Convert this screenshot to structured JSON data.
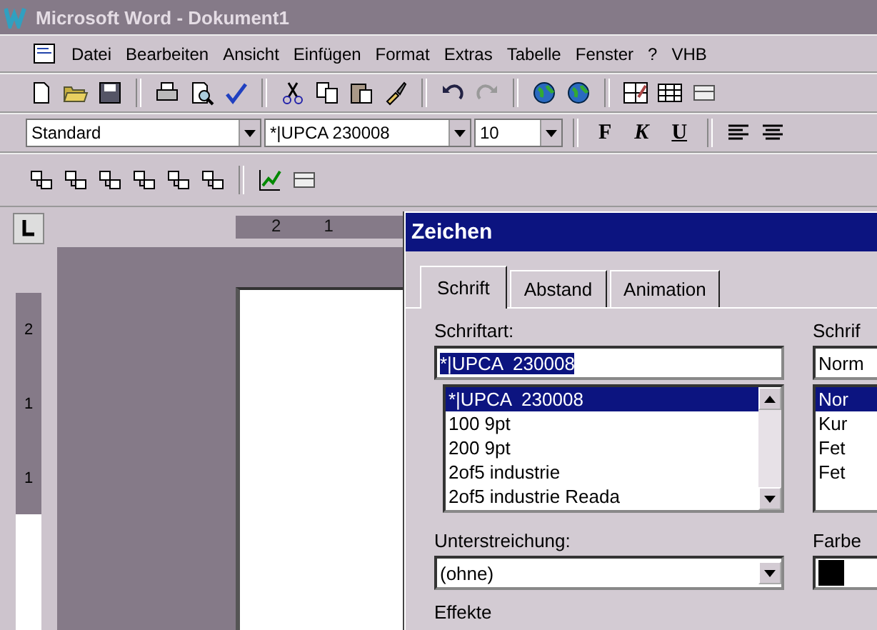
{
  "window": {
    "title": "Microsoft Word - Dokument1"
  },
  "menu": [
    "Datei",
    "Bearbeiten",
    "Ansicht",
    "Einfügen",
    "Format",
    "Extras",
    "Tabelle",
    "Fenster",
    "?",
    "VHB"
  ],
  "formatting": {
    "style": "Standard",
    "font": "*|UPCA  230008",
    "size": "10",
    "buttons": [
      {
        "label": "F",
        "kind": "bold"
      },
      {
        "label": "K",
        "kind": "italic"
      },
      {
        "label": "U",
        "kind": "underline"
      }
    ]
  },
  "ruler": {
    "horizontal": [
      "2",
      "1"
    ],
    "vertical": [
      "2",
      "1",
      "1"
    ]
  },
  "dialog": {
    "title": "Zeichen",
    "tabs": [
      {
        "label": "Schrift",
        "selected": true
      },
      {
        "label": "Abstand",
        "selected": false
      },
      {
        "label": "Animation",
        "selected": false
      }
    ],
    "font": {
      "label": "Schriftart:",
      "value": "*|UPCA  230008",
      "text_selected": true,
      "items": [
        {
          "label": "*|UPCA  230008",
          "selected": true
        },
        {
          "label": "100 9pt",
          "selected": false
        },
        {
          "label": "200 9pt",
          "selected": false
        },
        {
          "label": "2of5 industrie",
          "selected": false
        },
        {
          "label": "2of5 industrie Reada",
          "selected": false
        }
      ]
    },
    "style": {
      "label": "Schrif",
      "value": "Norm",
      "items": [
        {
          "label": "Nor",
          "selected": true
        },
        {
          "label": "Kur",
          "selected": false
        },
        {
          "label": "Fet",
          "selected": false
        },
        {
          "label": "Fet",
          "selected": false
        }
      ]
    },
    "underline": {
      "label": "Unterstreichung:",
      "value": "(ohne)"
    },
    "color": {
      "label": "Farbe",
      "color": "#000000"
    },
    "effects": {
      "label": "Effekte"
    }
  }
}
